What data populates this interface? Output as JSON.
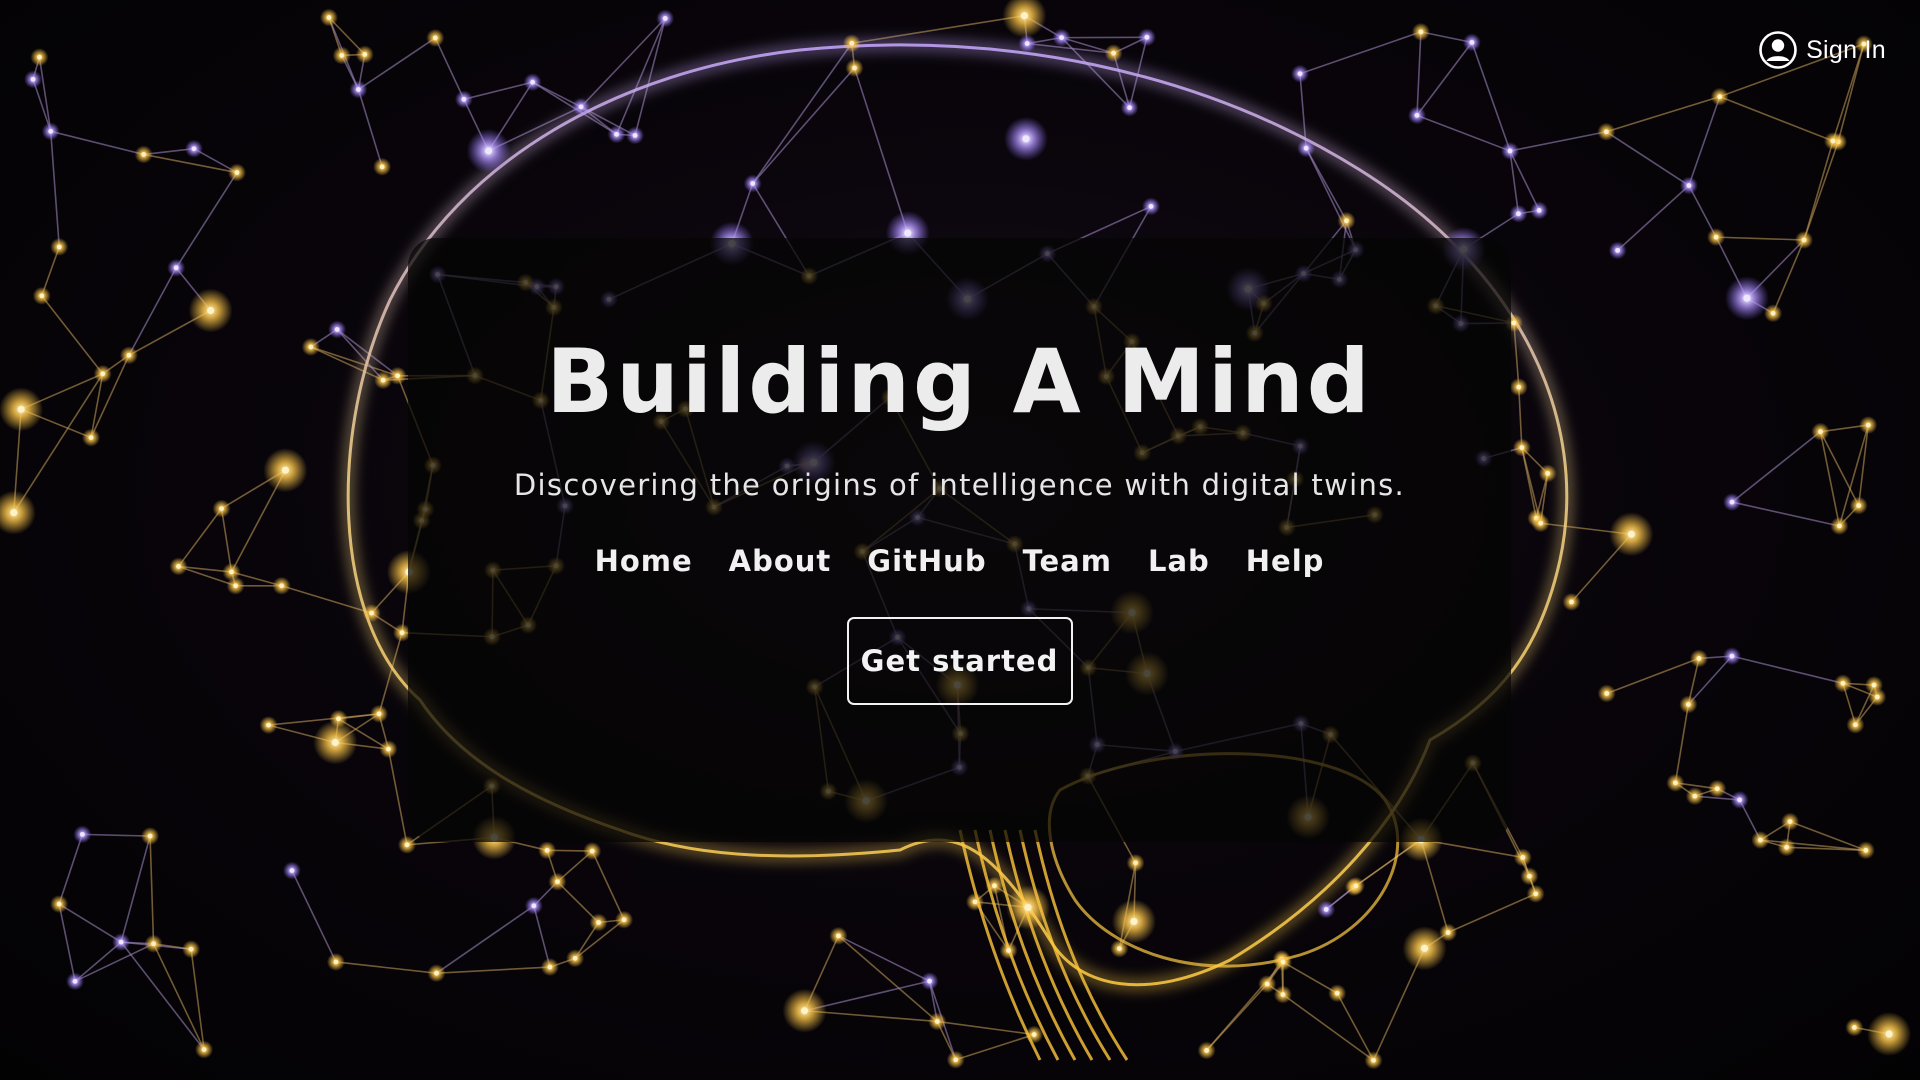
{
  "header": {
    "signin_icon": "user-circle-icon",
    "signin_label": "Sign In"
  },
  "hero": {
    "title": "Building A Mind",
    "subtitle": "Discovering the origins of intelligence with digital twins.",
    "nav": [
      {
        "label": "Home"
      },
      {
        "label": "About"
      },
      {
        "label": "GitHub"
      },
      {
        "label": "Team"
      },
      {
        "label": "Lab"
      },
      {
        "label": "Help"
      }
    ],
    "cta_label": "Get started"
  },
  "background": {
    "description_icon": "neural-network-brain-image",
    "colors": {
      "gold": "#ffc84a",
      "purple": "#a98bff",
      "deep": "#050306"
    }
  }
}
